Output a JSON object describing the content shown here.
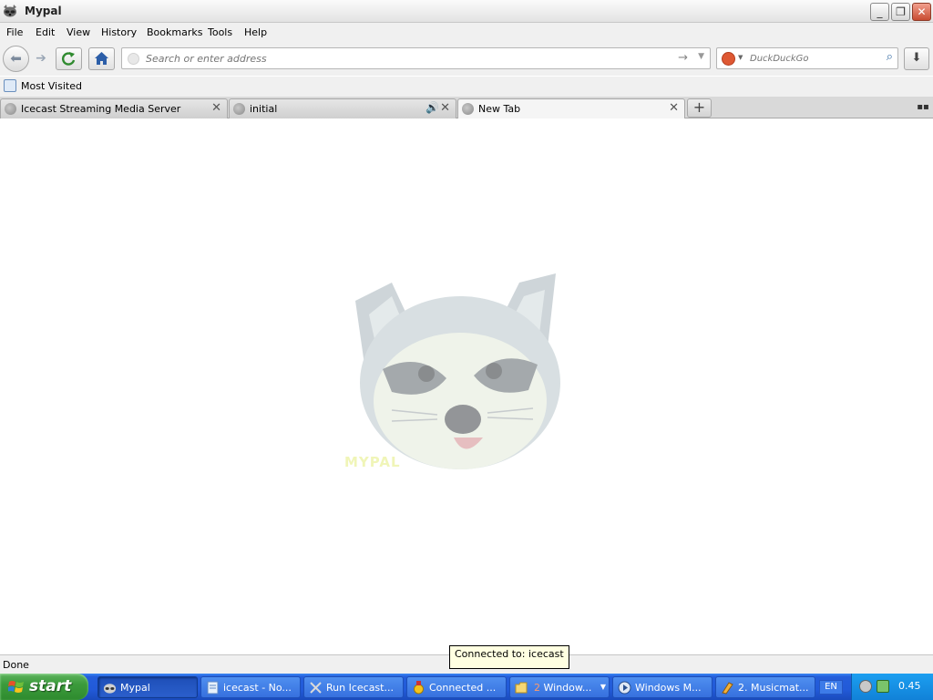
{
  "window": {
    "title": "Mypal",
    "icon": "raccoon-icon"
  },
  "menu": [
    "File",
    "Edit",
    "View",
    "History",
    "Bookmarks",
    "Tools",
    "Help"
  ],
  "nav": {
    "address_placeholder": "Search or enter address",
    "search_placeholder": "DuckDuckGo"
  },
  "bookmarks": {
    "most_visited": "Most Visited"
  },
  "tabs": [
    {
      "label": "Icecast Streaming Media Server",
      "active": false,
      "playing": false
    },
    {
      "label": "initial",
      "active": false,
      "playing": true
    },
    {
      "label": "New Tab",
      "active": true,
      "playing": false
    }
  ],
  "content": {
    "logo_text": "MYPAL"
  },
  "status": {
    "text": "Done"
  },
  "tooltip": {
    "text": "Connected to: icecast"
  },
  "taskbar": {
    "start_label": "start",
    "tasks": [
      {
        "label": "Mypal",
        "icon": "raccoon-icon",
        "active": true
      },
      {
        "label": "icecast - No...",
        "icon": "notepad-icon",
        "active": false
      },
      {
        "label": "Run Icecast...",
        "icon": "tools-icon",
        "active": false
      },
      {
        "label": "Connected ...",
        "icon": "medal-icon",
        "active": false
      },
      {
        "label": "Window...",
        "icon": "folder-icon",
        "active": false,
        "group_count": "2"
      },
      {
        "label": "Windows M...",
        "icon": "media-player-icon",
        "active": false
      },
      {
        "label": "2. Musicmat...",
        "icon": "musicmatch-icon",
        "active": false
      }
    ],
    "language": "EN",
    "clock": "0.45"
  }
}
